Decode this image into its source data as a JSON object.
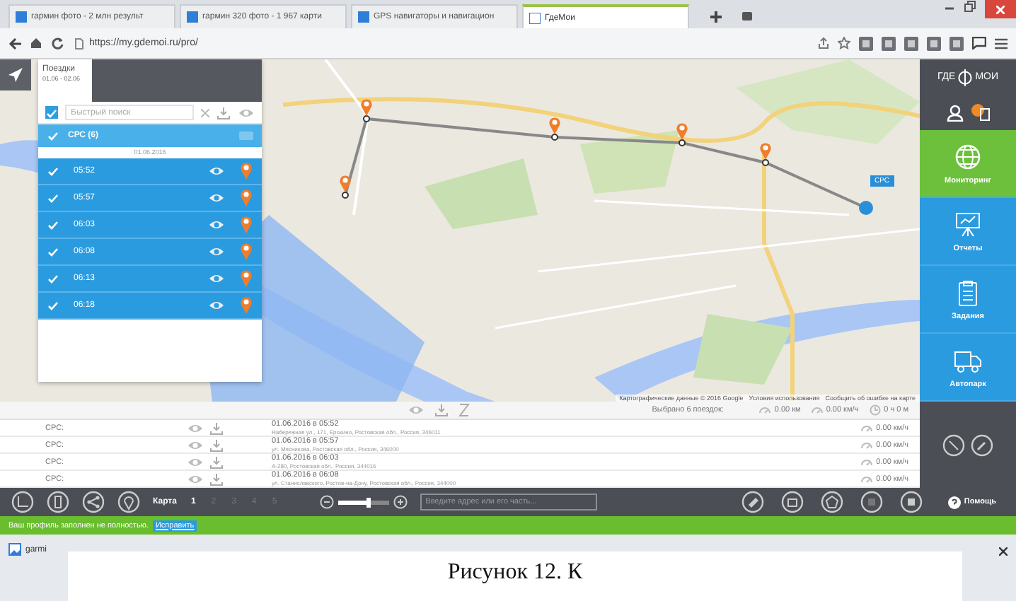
{
  "browser": {
    "tabs": [
      {
        "label": "гармин фото - 2 млн результ",
        "selected": false
      },
      {
        "label": "гармин 320 фото - 1 967 карти",
        "selected": false
      },
      {
        "label": "GPS навигаторы и навигацион",
        "selected": false
      },
      {
        "label": "ГдеМои",
        "selected": true
      }
    ],
    "address": "https://my.gdemoi.ru/pro/"
  },
  "trips_panel": {
    "tab": {
      "title": "Поездки",
      "dates": "01.06 - 02.06"
    },
    "search": {
      "placeholder": "Быстрый поиск",
      "checked": true
    },
    "group": {
      "label": "СРС (6)",
      "checked": true
    },
    "date": "01.06.2016",
    "trips": [
      {
        "time": "05:52",
        "checked": true
      },
      {
        "time": "05:57",
        "checked": true
      },
      {
        "time": "06:03",
        "checked": true
      },
      {
        "time": "06:08",
        "checked": true
      },
      {
        "time": "06:13",
        "checked": true
      },
      {
        "time": "06:18",
        "checked": true
      }
    ]
  },
  "map": {
    "vehicle_label": "СРС",
    "attribution": [
      "Картографические данные © 2016 Google",
      "Условия использования",
      "Сообщить об ошибке на карте"
    ]
  },
  "summary": {
    "label": "Выбрано 6 поездок:",
    "distance": "0.00 км",
    "speed": "0.00 км/ч",
    "duration": "0 ч 0 м"
  },
  "trip_table": {
    "rows": [
      {
        "name": "СРС:",
        "date": "01.06.2016 в 05:52",
        "address": "Набережная ул., 171, Ерохино, Ростовская обл., Россия, 346011",
        "speed": "0.00 км/ч"
      },
      {
        "name": "СРС:",
        "date": "01.06.2016 в 05:57",
        "address": "ул. Мясникова, Ростовская обл., Россия, 346000",
        "speed": "0.00 км/ч"
      },
      {
        "name": "СРС:",
        "date": "01.06.2016 в 06:03",
        "address": "А-280, Ростовская обл., Россия, 344016",
        "speed": "0.00 км/ч"
      },
      {
        "name": "СРС:",
        "date": "01.06.2016 в 06:08",
        "address": "ул. Станиславского, Ростов-на-Дону, Ростовская обл., Россия, 344000",
        "speed": "0.00 км/ч"
      }
    ]
  },
  "toolbar": {
    "map_label": "Карта",
    "maps": [
      {
        "label": "1",
        "selected": true
      },
      {
        "label": "2",
        "selected": false
      },
      {
        "label": "3",
        "selected": false
      },
      {
        "label": "4",
        "selected": false
      },
      {
        "label": "5",
        "selected": false
      }
    ],
    "zoom": {
      "level": 0.6
    },
    "address_search": {
      "placeholder": "Введите адрес или его часть..."
    },
    "help": "Помощь"
  },
  "notice": {
    "text": "Ваш профиль заполнен не полностью.",
    "link": "Исправить"
  },
  "sidebar": {
    "logo_left": "ГДЕ",
    "logo_right": "МОИ",
    "items": [
      {
        "label": "Мониторинг",
        "selected": true,
        "kind": "globe"
      },
      {
        "label": "Отчеты",
        "selected": false,
        "kind": "board"
      },
      {
        "label": "Задания",
        "selected": false,
        "kind": "clipboard"
      },
      {
        "label": "Автопарк",
        "selected": false,
        "kind": "truck"
      }
    ]
  },
  "taskbar": {
    "items": [
      "garmi"
    ]
  },
  "caption": "Рисунок 12. К"
}
